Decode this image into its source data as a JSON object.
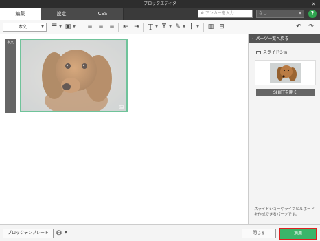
{
  "window": {
    "title": "ブロックエディタ",
    "close_glyph": "×"
  },
  "tabs": [
    {
      "label": "編集",
      "active": true
    },
    {
      "label": "設定",
      "active": false
    },
    {
      "label": "CSS",
      "active": false
    }
  ],
  "anchor": {
    "placeholder": "アンカーを入力",
    "hash": "#"
  },
  "target_select": {
    "value": "なし"
  },
  "help": {
    "label": "?"
  },
  "toolbar": {
    "style_select": "本文",
    "icons": [
      "bulleted-list",
      "box",
      "align-left",
      "align-center",
      "align-right",
      "indent-decrease",
      "indent-increase",
      "text-size",
      "line-height",
      "eyedropper",
      "special-chars",
      "columns",
      "undo",
      "redo"
    ]
  },
  "canvas": {
    "block_label": "本文",
    "colors": {
      "border": "#6fc39a",
      "label_bar": "#666666"
    }
  },
  "right_panel": {
    "back_label": "パーツ一覧へ戻る",
    "part_title": "スライドショー",
    "shift_button": "SHIFTを開く",
    "description": "スライドショーやライブビルボードを作成できるパーツです。"
  },
  "footer": {
    "template_button": "ブロックテンプレート",
    "close_button": "閉じる",
    "apply_button": "適用",
    "colors": {
      "apply": "#3bb56a",
      "highlight": "#e02020"
    }
  }
}
